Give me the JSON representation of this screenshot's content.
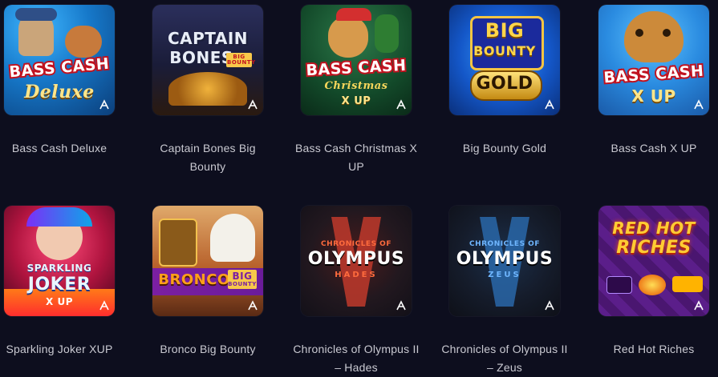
{
  "games": [
    {
      "title": "Bass Cash Deluxe",
      "art": {
        "line1": "BASS CASH",
        "line2": "Deluxe",
        "line3": ""
      }
    },
    {
      "title": "Captain Bones Big Bounty",
      "art": {
        "line1": "CAPTAIN",
        "line2": "BONES",
        "line3": "BIG BOUNTY"
      }
    },
    {
      "title": "Bass Cash Christmas X UP",
      "art": {
        "line1": "BASS CASH",
        "line2": "Christmas",
        "line3": "X UP"
      }
    },
    {
      "title": "Big Bounty Gold",
      "art": {
        "line1": "BIG",
        "line2": "BOUNTY",
        "line3": "GOLD"
      }
    },
    {
      "title": "Bass Cash X UP",
      "art": {
        "line1": "BASS CASH",
        "line2": "X UP",
        "line3": ""
      }
    },
    {
      "title": "Sparkling Joker XUP",
      "art": {
        "line1": "SPARKLING",
        "line2": "JOKER",
        "line3": "X UP"
      }
    },
    {
      "title": "Bronco Big Bounty",
      "art": {
        "line1": "BRONCO",
        "line2": "BIG",
        "line3": "BOUNTY"
      }
    },
    {
      "title": "Chronicles of Olympus II – Hades",
      "art": {
        "line1": "CHRONICLES OF",
        "line2": "OLYMPUS",
        "line3": "HADES"
      }
    },
    {
      "title": "Chronicles of Olympus II – Zeus",
      "art": {
        "line1": "CHRONICLES OF",
        "line2": "OLYMPUS",
        "line3": "ZEUS"
      }
    },
    {
      "title": "Red Hot Riches",
      "art": {
        "line1": "RED HOT",
        "line2": "RICHES",
        "line3": ""
      }
    }
  ],
  "colors": {
    "background": "#0d0e1e",
    "title_text": "#c9c9d1"
  },
  "icons": {
    "provider_badge": "provider-logo-icon"
  }
}
